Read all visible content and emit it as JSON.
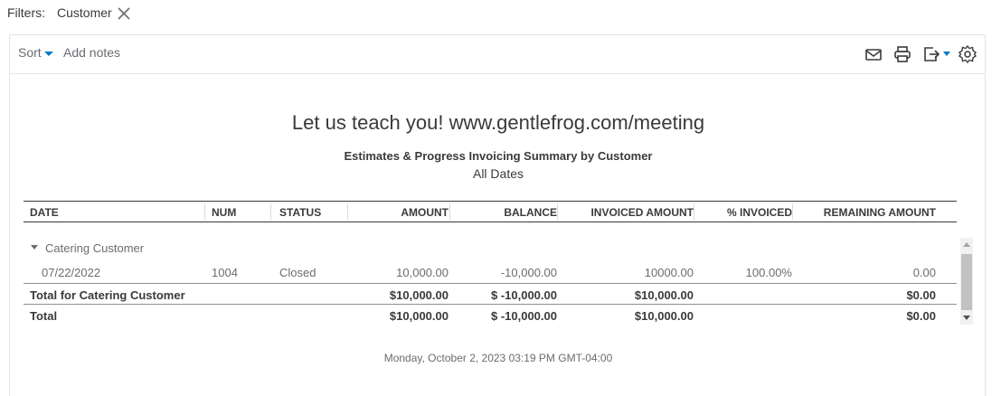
{
  "filters": {
    "label": "Filters:",
    "chips": [
      {
        "label": "Customer",
        "icon": "close-icon"
      }
    ]
  },
  "toolbar": {
    "sort_label": "Sort",
    "add_notes_label": "Add notes",
    "icons": [
      "email-icon",
      "print-icon",
      "export-icon",
      "settings-icon"
    ]
  },
  "report": {
    "title": "Let us teach you! www.gentlefrog.com/meeting",
    "subtitle": "Estimates & Progress Invoicing Summary by Customer",
    "dates": "All Dates",
    "columns": [
      "DATE",
      "NUM",
      "STATUS",
      "AMOUNT",
      "BALANCE",
      "INVOICED AMOUNT",
      "% INVOICED",
      "REMAINING AMOUNT"
    ],
    "group": {
      "name": "Catering Customer"
    },
    "rows": [
      {
        "date": "07/22/2022",
        "num": "1004",
        "status": "Closed",
        "amount": "10,000.00",
        "balance": "-10,000.00",
        "invoiced": "10000.00",
        "pct": "100.00%",
        "remaining": "0.00"
      }
    ],
    "group_total": {
      "label": "Total for Catering Customer",
      "amount": "$10,000.00",
      "balance": "$ -10,000.00",
      "invoiced": "$10,000.00",
      "remaining": "$0.00"
    },
    "grand_total": {
      "label": "Total",
      "amount": "$10,000.00",
      "balance": "$ -10,000.00",
      "invoiced": "$10,000.00",
      "remaining": "$0.00"
    },
    "footer": "Monday, October 2, 2023   03:19 PM GMT-04:00"
  },
  "colors": {
    "accent": "#0077c5",
    "text": "#393a3d",
    "muted": "#6b6c72"
  }
}
